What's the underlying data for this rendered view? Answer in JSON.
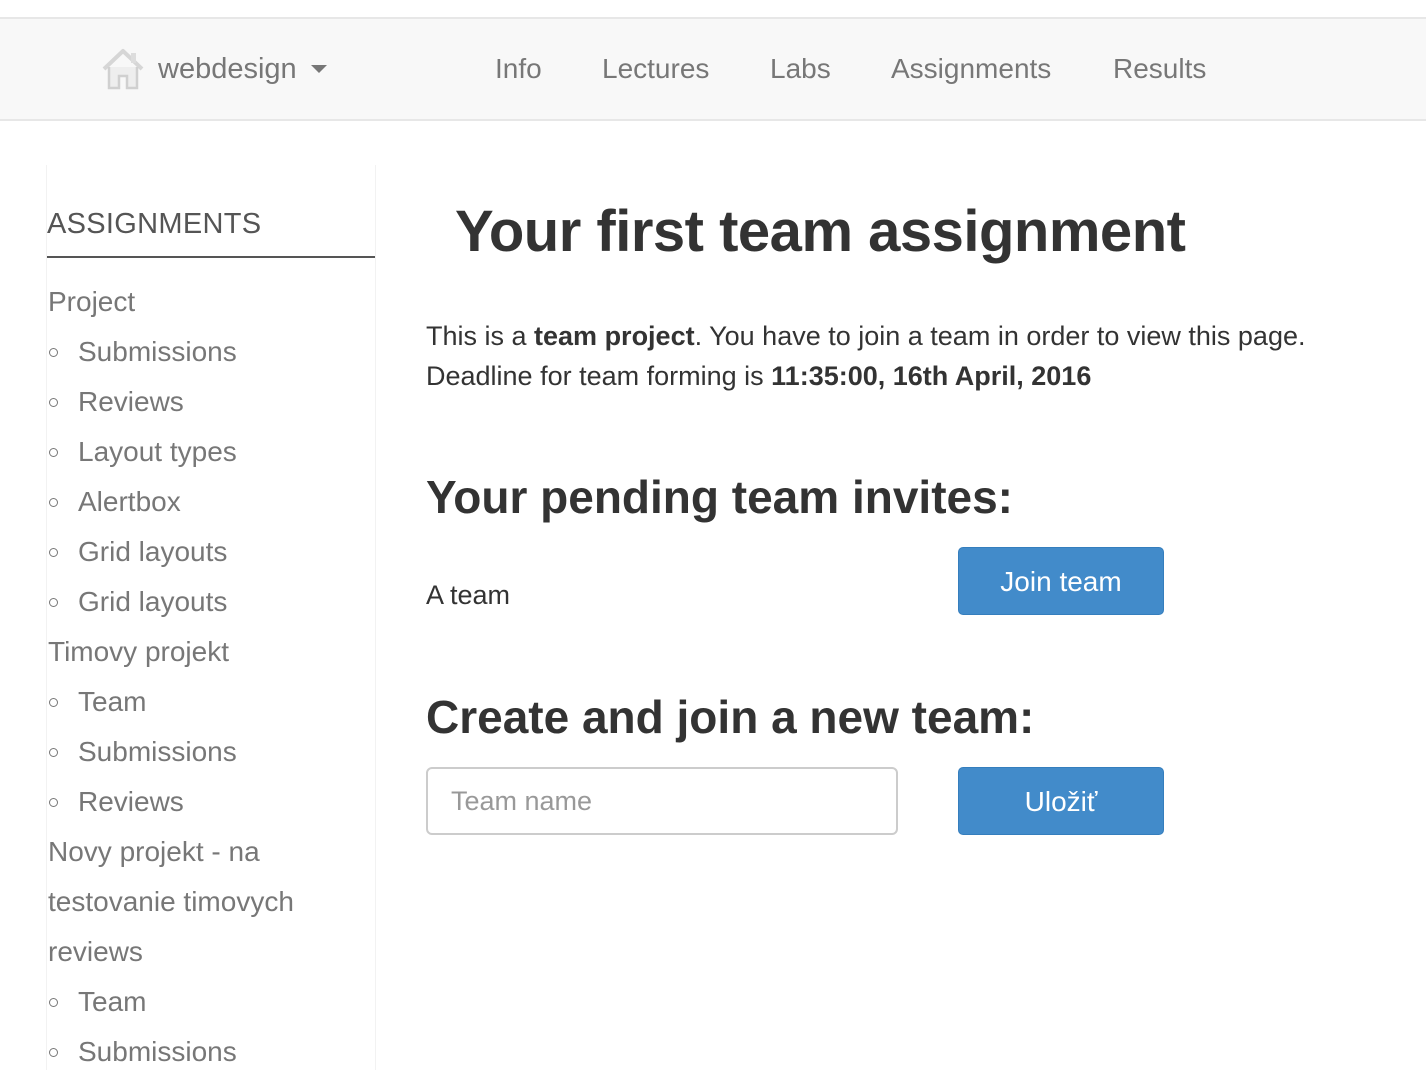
{
  "navbar": {
    "brand_icon": "home-icon",
    "brand_label": "webdesign",
    "items": [
      {
        "label": "Info"
      },
      {
        "label": "Lectures"
      },
      {
        "label": "Labs"
      },
      {
        "label": "Assignments"
      },
      {
        "label": "Results"
      }
    ]
  },
  "sidebar": {
    "title": "ASSIGNMENTS",
    "groups": [
      {
        "label": "Project",
        "items": [
          "Submissions",
          "Reviews",
          "Layout types",
          "Alertbox",
          "Grid layouts",
          "Grid layouts"
        ]
      },
      {
        "label": "Timovy projekt",
        "items": [
          "Team",
          "Submissions",
          "Reviews"
        ]
      },
      {
        "label_lines": [
          "Novy projekt - na",
          "testovanie timovych",
          "reviews"
        ],
        "items": [
          "Team",
          "Submissions"
        ]
      }
    ]
  },
  "main": {
    "title": "Your first team assignment",
    "intro": {
      "line1_prefix": "This is a ",
      "line1_bold": "team project",
      "line1_suffix": ". You have to join a team in order to view this page.",
      "line2_prefix": "Deadline for team forming is ",
      "line2_bold": "11:35:00, 16th April, 2016"
    },
    "pending": {
      "heading": "Your pending team invites:",
      "team_name": "A team",
      "join_label": "Join team"
    },
    "create": {
      "heading": "Create and join a new team:",
      "placeholder": "Team name",
      "value": "",
      "save_label": "Uložiť"
    }
  }
}
